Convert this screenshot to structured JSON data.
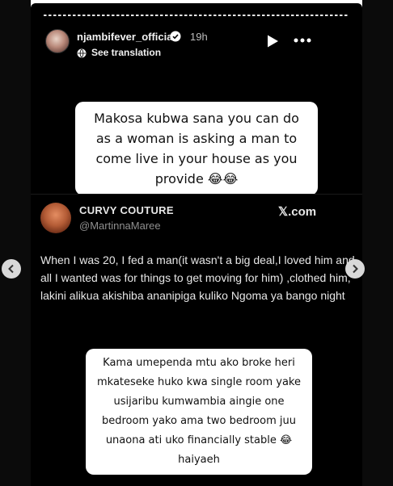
{
  "story": {
    "username": "njambifever_official",
    "time_ago": "19h",
    "translate_label": "See translation",
    "caption_top": "Makosa kubwa sana you can do as a woman is asking a man to come live in your house as you provide 😂😂",
    "caption_bottom": "Kama umependa mtu ako broke heri mkateseke huko kwa single room yake usijaribu kumwambia aingie one bedroom yako ama two bedroom juu unaona ati uko financially stable 😂 haiyaeh"
  },
  "tweet": {
    "display_name": "CURVY COUTURE",
    "handle": "@MartinnaMaree",
    "brand": "𝕏.com",
    "body": "When I was 20, I fed a man(it wasn't a big deal,I loved him and all I wanted was for things to get moving for him) ,clothed him, lakini alikua akishiba ananipiga kuliko Ngoma ya bango night"
  },
  "icons": {
    "verified": "verified-badge-icon",
    "translate": "globe-icon",
    "play": "play-icon",
    "more": "more-options-icon",
    "prev": "chevron-left-icon",
    "next": "chevron-right-icon"
  },
  "colors": {
    "background": "#000000",
    "caption_bg": "#ffffff",
    "text_light": "#e7e7e7",
    "text_muted": "#8f8f8f"
  }
}
